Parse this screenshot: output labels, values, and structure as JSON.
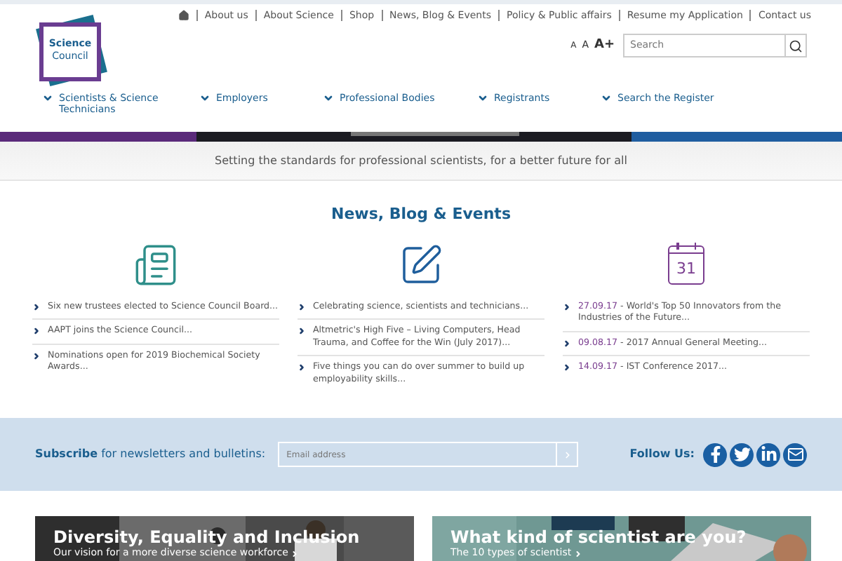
{
  "top_links": [
    "About us",
    "About Science",
    "Shop",
    "News, Blog & Events",
    "Policy & Public affairs",
    "Resume my Application",
    "Contact us"
  ],
  "logo": {
    "line1": "Science",
    "line2": "Council"
  },
  "font_sizes": [
    "A",
    "A",
    "A+"
  ],
  "search": {
    "placeholder": "Search"
  },
  "nav": [
    "Scientists & Science Technicians",
    "Employers",
    "Professional Bodies",
    "Registrants",
    "Search the Register"
  ],
  "tagline": "Setting the standards for professional scientists, for a better future for all",
  "section_title": "News, Blog & Events",
  "columns": [
    {
      "kind": "news",
      "items": [
        {
          "text": "Six new trustees elected to Science Council Board..."
        },
        {
          "text": "AAPT joins the Science Council..."
        },
        {
          "text": "Nominations open for 2019 Biochemical Society Awards..."
        }
      ]
    },
    {
      "kind": "blog",
      "items": [
        {
          "text": "Celebrating science, scientists and technicians..."
        },
        {
          "text": "Altmetric's High Five – Living Computers, Head Trauma, and Coffee for the Win (July 2017)..."
        },
        {
          "text": "Five things you can do over summer to build up employability skills..."
        }
      ]
    },
    {
      "kind": "events",
      "icon_text": "31",
      "items": [
        {
          "date": "27.09.17",
          "text": " - World's Top 50 Innovators from the Industries of the Future..."
        },
        {
          "date": "09.08.17",
          "text": " - 2017 Annual General Meeting..."
        },
        {
          "date": "14.09.17",
          "text": " - IST Conference 2017..."
        }
      ]
    }
  ],
  "subscribe": {
    "label": "Subscribe",
    "rest": " for newsletters and bulletins:",
    "placeholder": "Email address"
  },
  "follow": {
    "label": "Follow Us:",
    "icons": [
      {
        "kind": "facebook"
      },
      {
        "kind": "twitter"
      },
      {
        "kind": "linkedin"
      },
      {
        "kind": "email"
      }
    ]
  },
  "cards": [
    {
      "title": "Diversity, Equality and Inclusion",
      "subtitle": "Our vision for a more diverse science workforce"
    },
    {
      "title": "What kind of scientist are you?",
      "subtitle": "The 10 types of scientist"
    }
  ]
}
